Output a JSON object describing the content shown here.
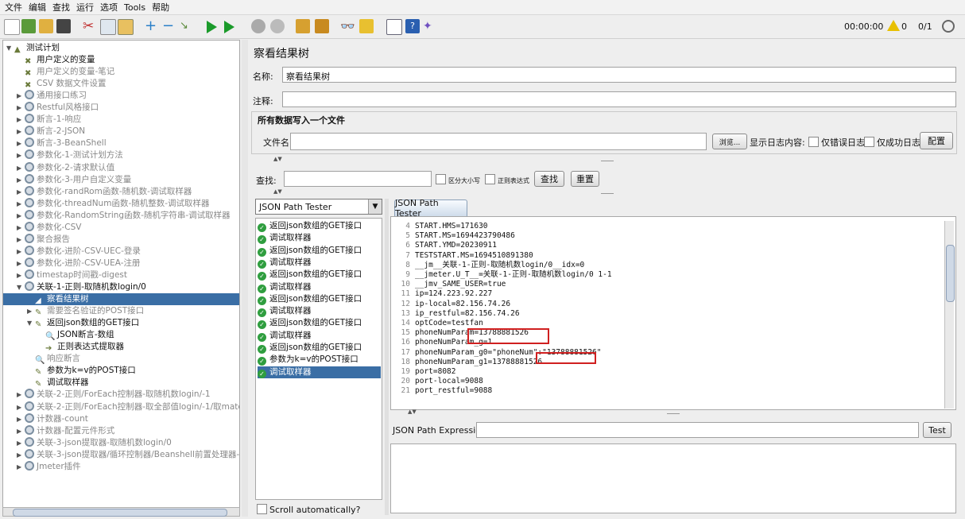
{
  "menu": [
    "文件",
    "编辑",
    "查找",
    "运行",
    "选项",
    "Tools",
    "帮助"
  ],
  "toolbar": {
    "timer": "00:00:00",
    "warnings": "0",
    "threads": "0/1"
  },
  "tree": [
    {
      "label": "测试计划",
      "level": 0,
      "arrow": "▼",
      "icon": "flask-icon",
      "grey": false
    },
    {
      "label": "用户定义的变量",
      "level": 1,
      "arrow": "",
      "icon": "wrench-icon",
      "grey": false
    },
    {
      "label": "用户定义的变量-笔记",
      "level": 1,
      "arrow": "",
      "icon": "wrench-icon",
      "grey": true
    },
    {
      "label": "CSV 数据文件设置",
      "level": 1,
      "arrow": "",
      "icon": "wrench-icon",
      "grey": true
    },
    {
      "label": "通用接口练习",
      "level": 1,
      "arrow": "▶",
      "icon": "gear-icon",
      "grey": true
    },
    {
      "label": "Restful风格接口",
      "level": 1,
      "arrow": "▶",
      "icon": "gear-icon",
      "grey": true
    },
    {
      "label": "断言-1-响应",
      "level": 1,
      "arrow": "▶",
      "icon": "gear-icon",
      "grey": true
    },
    {
      "label": "断言-2-JSON",
      "level": 1,
      "arrow": "▶",
      "icon": "gear-icon",
      "grey": true
    },
    {
      "label": "断言-3-BeanShell",
      "level": 1,
      "arrow": "▶",
      "icon": "gear-icon",
      "grey": true
    },
    {
      "label": "参数化-1-测试计划方法",
      "level": 1,
      "arrow": "▶",
      "icon": "gear-icon",
      "grey": true
    },
    {
      "label": "参数化-2-请求默认值",
      "level": 1,
      "arrow": "▶",
      "icon": "gear-icon",
      "grey": true
    },
    {
      "label": "参数化-3-用户自定义变量",
      "level": 1,
      "arrow": "▶",
      "icon": "gear-icon",
      "grey": true
    },
    {
      "label": "参数化-randRom函数-随机数-调试取样器",
      "level": 1,
      "arrow": "▶",
      "icon": "gear-icon",
      "grey": true
    },
    {
      "label": "参数化-threadNum函数-随机整数-调试取样器",
      "level": 1,
      "arrow": "▶",
      "icon": "gear-icon",
      "grey": true
    },
    {
      "label": "参数化-RandomString函数-随机字符串-调试取样器",
      "level": 1,
      "arrow": "▶",
      "icon": "gear-icon",
      "grey": true
    },
    {
      "label": "参数化-CSV",
      "level": 1,
      "arrow": "▶",
      "icon": "gear-icon",
      "grey": true
    },
    {
      "label": "聚合报告",
      "level": 1,
      "arrow": "▶",
      "icon": "gear-icon",
      "grey": true
    },
    {
      "label": "参数化-进阶-CSV-UEC-登录",
      "level": 1,
      "arrow": "▶",
      "icon": "gear-icon",
      "grey": true
    },
    {
      "label": "参数化-进阶-CSV-UEA-注册",
      "level": 1,
      "arrow": "▶",
      "icon": "gear-icon",
      "grey": true
    },
    {
      "label": "timestap时间戳-digest",
      "level": 1,
      "arrow": "▶",
      "icon": "gear-icon",
      "grey": true
    },
    {
      "label": "关联-1-正则-取随机数login/0",
      "level": 1,
      "arrow": "▼",
      "icon": "gear-icon",
      "grey": false
    },
    {
      "label": "察看结果树",
      "level": 2,
      "arrow": "",
      "icon": "chart-icon",
      "grey": false,
      "selected": true
    },
    {
      "label": "需要签名验证的POST接口",
      "level": 2,
      "arrow": "▶",
      "icon": "pen-icon",
      "grey": true
    },
    {
      "label": "返回json数组的GET接口",
      "level": 2,
      "arrow": "▼",
      "icon": "pen-icon",
      "grey": false
    },
    {
      "label": "JSON断言-数组",
      "level": 3,
      "arrow": "",
      "icon": "magnifier-icon",
      "grey": false
    },
    {
      "label": "正则表达式提取器",
      "level": 3,
      "arrow": "",
      "icon": "arrow-icon",
      "grey": false
    },
    {
      "label": "响应断言",
      "level": 2,
      "arrow": "",
      "icon": "magnifier-icon",
      "grey": true
    },
    {
      "label": "参数为k=v的POST接口",
      "level": 2,
      "arrow": "",
      "icon": "pen-icon",
      "grey": false
    },
    {
      "label": "调试取样器",
      "level": 2,
      "arrow": "",
      "icon": "pen-icon",
      "grey": false
    },
    {
      "label": "关联-2-正则/ForEach控制器-取随机数login/-1",
      "level": 1,
      "arrow": "▶",
      "icon": "gear-icon",
      "grey": true
    },
    {
      "label": "关联-2-正则/ForEach控制器-取全部值login/-1/取matchNr",
      "level": 1,
      "arrow": "▶",
      "icon": "gear-icon",
      "grey": true
    },
    {
      "label": "计数器-count",
      "level": 1,
      "arrow": "▶",
      "icon": "gear-icon",
      "grey": true
    },
    {
      "label": "计数器-配置元件形式",
      "level": 1,
      "arrow": "▶",
      "icon": "gear-icon",
      "grey": true
    },
    {
      "label": "关联-3-json提取器-取随机数login/0",
      "level": 1,
      "arrow": "▶",
      "icon": "gear-icon",
      "grey": true
    },
    {
      "label": "关联-3-json提取器/循环控制器/Beanshell前置处理器-取全部",
      "level": 1,
      "arrow": "▶",
      "icon": "gear-icon",
      "grey": true
    },
    {
      "label": "Jmeter插件",
      "level": 1,
      "arrow": "▶",
      "icon": "gear-icon",
      "grey": true
    }
  ],
  "panel": {
    "title": "察看结果树",
    "name_label": "名称:",
    "name_value": "察看结果树",
    "comment_label": "注释:",
    "write_all_label": "所有数据写入一个文件",
    "filename_label": "文件名",
    "browse_label": "浏览...",
    "log_label": "显示日志内容:",
    "errors_only": "仅错误日志",
    "success_only": "仅成功日志",
    "config_label": "配置",
    "search_label": "查找:",
    "case_label": "区分大小写",
    "regex_label": "正则表达式",
    "find_btn": "查找",
    "reset_btn": "重置"
  },
  "renderer": "JSON Path Tester",
  "samples": [
    "返回json数组的GET接口",
    "调试取样器",
    "返回json数组的GET接口",
    "调试取样器",
    "返回json数组的GET接口",
    "调试取样器",
    "返回json数组的GET接口",
    "调试取样器",
    "返回json数组的GET接口",
    "调试取样器",
    "返回json数组的GET接口",
    "参数为k=v的POST接口",
    "调试取样器"
  ],
  "scroll_auto": "Scroll automatically?",
  "tab_label": "JSON Path Tester",
  "result_lines": [
    {
      "n": "4",
      "t": "START.HMS=171630"
    },
    {
      "n": "5",
      "t": "START.MS=1694423790486"
    },
    {
      "n": "6",
      "t": "START.YMD=20230911"
    },
    {
      "n": "7",
      "t": "TESTSTART.MS=1694510891380"
    },
    {
      "n": "8",
      "t": "__jm__关联-1-正则-取随机数login/0__idx=0"
    },
    {
      "n": "9",
      "t": "__jmeter.U_T__=关联-1-正则-取随机数login/0 1-1"
    },
    {
      "n": "10",
      "t": "__jmv_SAME_USER=true"
    },
    {
      "n": "11",
      "t": "ip=124.223.92.227"
    },
    {
      "n": "12",
      "t": "ip-local=82.156.74.26"
    },
    {
      "n": "13",
      "t": "ip_restful=82.156.74.26"
    },
    {
      "n": "14",
      "t": "optCode=testfan"
    },
    {
      "n": "15",
      "t": "phoneNumParam=13788881526"
    },
    {
      "n": "16",
      "t": "phoneNumParam_g=1"
    },
    {
      "n": "17",
      "t": "phoneNumParam_g0=\"phoneNum\":\"13788881526\""
    },
    {
      "n": "18",
      "t": "phoneNumParam_g1=13788881526"
    },
    {
      "n": "19",
      "t": "port=8082"
    },
    {
      "n": "20",
      "t": "port-local=9088"
    },
    {
      "n": "21",
      "t": "port_restful=9088"
    }
  ],
  "json_path_label": "JSON Path Expression",
  "test_btn": "Test"
}
